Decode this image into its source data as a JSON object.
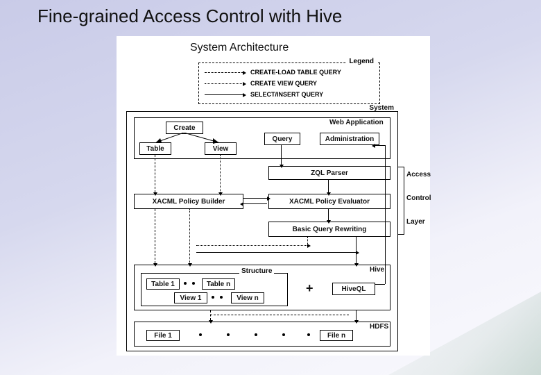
{
  "title": "Fine-grained Access Control with Hive",
  "subtitle": "System Architecture",
  "legend": {
    "tag": "Legend",
    "items": [
      {
        "style": "dashed",
        "label": "CREATE-LOAD TABLE QUERY"
      },
      {
        "style": "dotted",
        "label": "CREATE VIEW QUERY"
      },
      {
        "style": "solid",
        "label": "SELECT/INSERT QUERY"
      }
    ]
  },
  "labels": {
    "system": "System",
    "webapp": "Web Application",
    "create": "Create",
    "table": "Table",
    "view": "View",
    "query": "Query",
    "admin": "Administration",
    "zql": "ZQL Parser",
    "builder": "XACML Policy Builder",
    "evaluator": "XACML Policy Evaluator",
    "rewriting": "Basic Query Rewriting",
    "structure": "Structure",
    "hive": "Hive",
    "hiveql": "HiveQL",
    "hdfs": "HDFS",
    "table1": "Table 1",
    "tablen": "Table n",
    "view1": "View 1",
    "viewn": "View n",
    "file1": "File 1",
    "filen": "File n"
  },
  "side": {
    "access": "Access",
    "control": "Control",
    "layer": "Layer"
  }
}
